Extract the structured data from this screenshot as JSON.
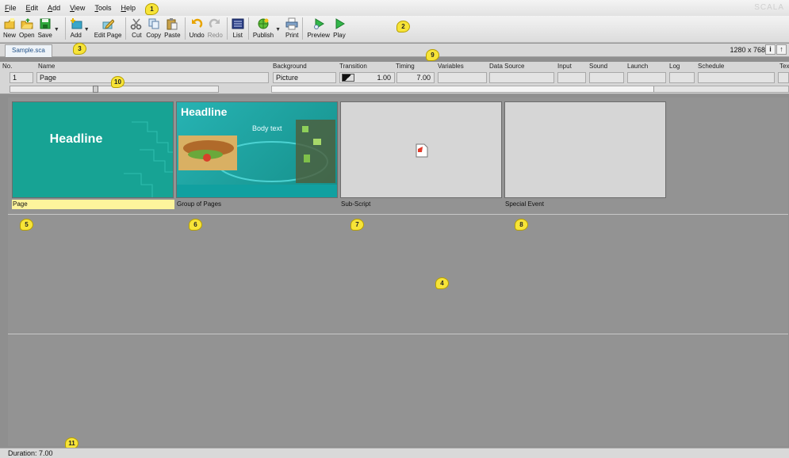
{
  "menu": [
    "File",
    "Edit",
    "Add",
    "View",
    "Tools",
    "Help"
  ],
  "brand": "SCALA",
  "toolbar": {
    "new": "New",
    "open": "Open",
    "save": "Save",
    "add": "Add",
    "edit_page": "Edit Page",
    "cut": "Cut",
    "copy": "Copy",
    "paste": "Paste",
    "undo": "Undo",
    "redo": "Redo",
    "list": "List",
    "publish": "Publish",
    "print": "Print",
    "preview": "Preview",
    "play": "Play"
  },
  "tab": {
    "label": "Sample.sca"
  },
  "resolution": "1280 x 768",
  "columns": [
    "No.",
    "Name",
    "Background",
    "Transition",
    "Timing",
    "Variables",
    "Data Source",
    "Input",
    "Sound",
    "Launch",
    "Log",
    "Schedule",
    "Text"
  ],
  "row": {
    "no": "1",
    "name": "Page",
    "background": "Picture",
    "transition": "1.00",
    "timing": "7.00"
  },
  "thumbnails": [
    {
      "label": "Page",
      "headline": "Headline"
    },
    {
      "label": "Group of Pages",
      "headline": "Headline",
      "body": "Body text"
    },
    {
      "label": "Sub-Script"
    },
    {
      "label": "Special Event"
    }
  ],
  "callouts": [
    "1",
    "2",
    "3",
    "4",
    "5",
    "6",
    "7",
    "8",
    "9",
    "10",
    "11"
  ],
  "status": {
    "duration": "Duration: 7.00"
  },
  "colors": {
    "teal": "#1aa99a",
    "selected_label": "#fdf49c",
    "callout": "#f7e438"
  }
}
